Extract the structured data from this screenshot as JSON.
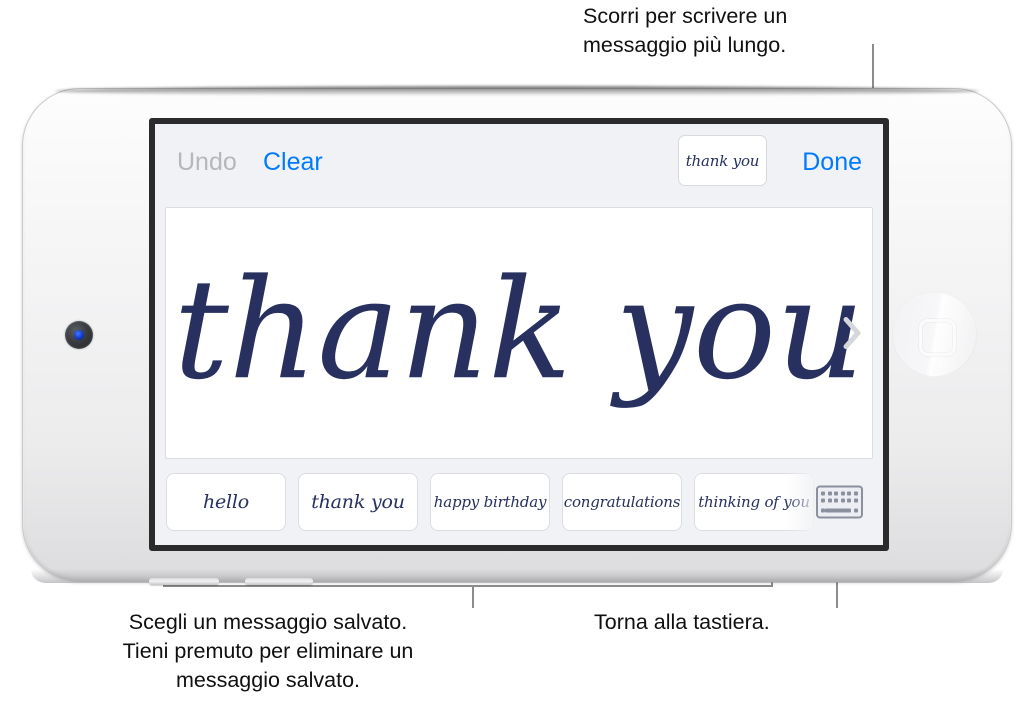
{
  "callouts": {
    "top": "Scorri per scrivere un\nmessaggio più lungo.",
    "bottom_left": "Scegli un messaggio salvato.\nTieni premuto per eliminare un\nmessaggio salvato.",
    "bottom_right": "Torna alla tastiera."
  },
  "device": {
    "camera_name": "front-camera",
    "home_button_name": "home-button",
    "volume_up_label": "",
    "volume_down_label": ""
  },
  "screen": {
    "toolbar": {
      "undo_label": "Undo",
      "clear_label": "Clear",
      "done_label": "Done",
      "current_preview_text": "thank you"
    },
    "canvas": {
      "ink_text": "thank you",
      "ink_color": "#20295a",
      "scroll_chevron": "chevron-right-icon"
    },
    "saved_messages": {
      "items": [
        {
          "text": "hello"
        },
        {
          "text": "thank you"
        },
        {
          "text": "happy birthday"
        },
        {
          "text": "congratulations"
        },
        {
          "text": "thinking of you"
        }
      ],
      "keyboard_button": "keyboard-icon"
    }
  },
  "colors": {
    "accent_blue": "#007aff",
    "disabled_gray": "#b6b7bb",
    "ink_navy": "#20295a",
    "screen_bg": "#f1f2f5",
    "leader_line": "#8c8c8c"
  }
}
